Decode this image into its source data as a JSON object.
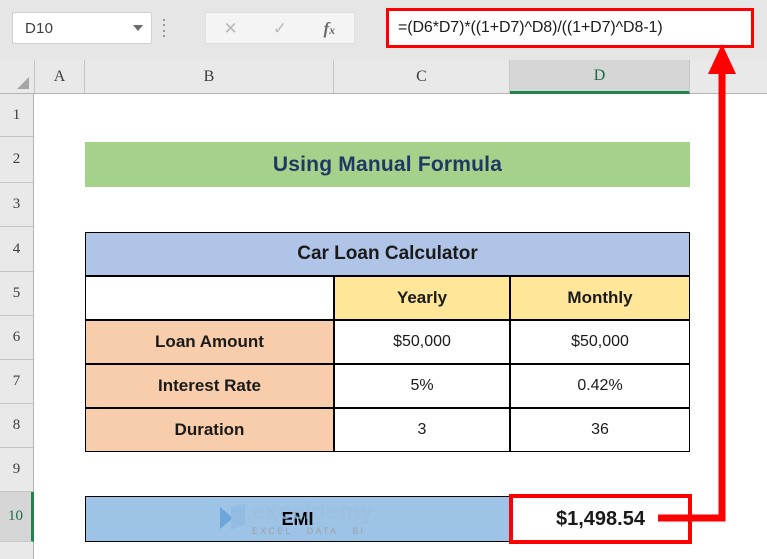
{
  "app": {
    "name_box": {
      "value": "D10",
      "icon": "chevron-down-icon"
    },
    "formula_bar": {
      "cancel_label": "✕",
      "enter_label": "✓",
      "insert_function_label": "fx",
      "formula": "=(D6*D7)*((1+D7)^D8)/((1+D7)^D8-1)"
    }
  },
  "grid": {
    "columns": [
      "A",
      "B",
      "C",
      "D"
    ],
    "selected_column": "D",
    "rows": [
      "1",
      "2",
      "3",
      "4",
      "5",
      "6",
      "7",
      "8",
      "9",
      "10"
    ],
    "selected_row": "10"
  },
  "sheet": {
    "banner": {
      "title": "Using Manual Formula"
    },
    "table": {
      "title": "Car Loan Calculator",
      "headers": [
        "",
        "Yearly",
        "Monthly"
      ],
      "rows": [
        {
          "label": "Loan Amount",
          "yearly": "$50,000",
          "monthly": "$50,000"
        },
        {
          "label": "Interest Rate",
          "yearly": "5%",
          "monthly": "0.42%"
        },
        {
          "label": "Duration",
          "yearly": "3",
          "monthly": "36"
        }
      ]
    },
    "result": {
      "label": "EMI",
      "value": "$1,498.54"
    }
  },
  "watermark": {
    "name": "exceldemy",
    "tagline": "EXCEL · DATA · BI"
  },
  "colors": {
    "banner_fill": "#a5d28a",
    "banner_text": "#1f3864",
    "table_title_fill": "#b0c4e8",
    "table_header_fill": "#ffe699",
    "row_label_fill": "#f8cdab",
    "result_fill": "#9dc3e6",
    "annotation": "#ff0000",
    "selection_green": "#21844a"
  }
}
